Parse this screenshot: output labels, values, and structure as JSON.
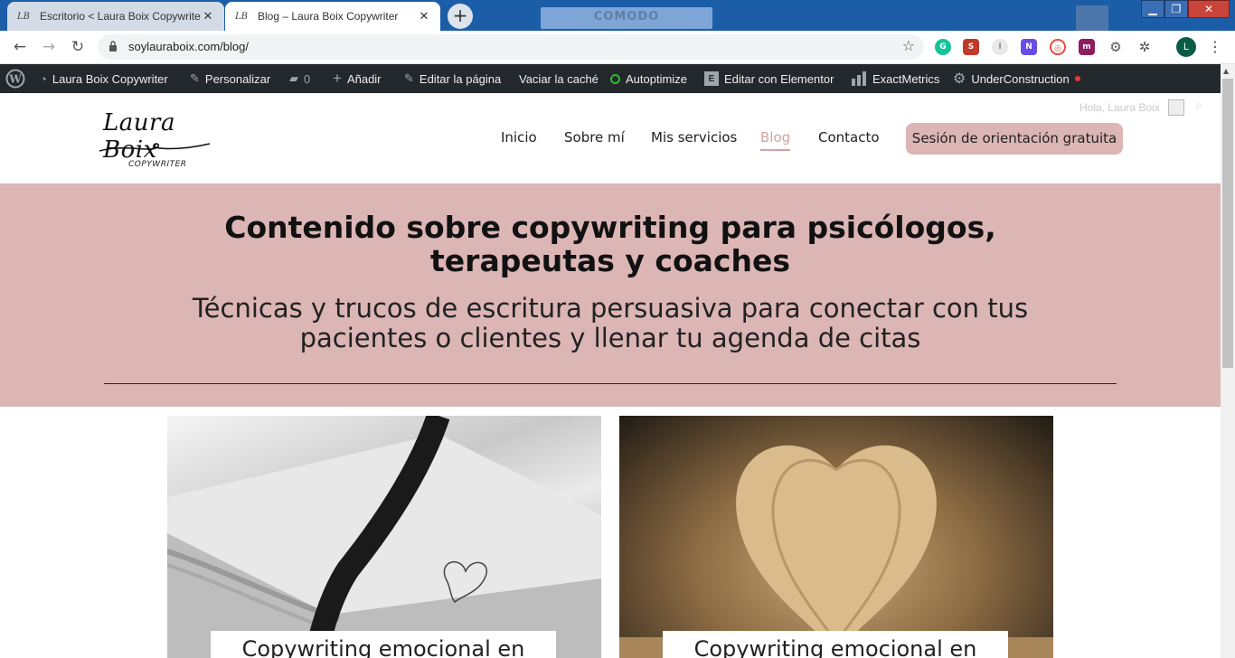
{
  "browser": {
    "tabs": [
      {
        "title": "Escritorio < Laura Boix Copywrite",
        "favicon": "LB",
        "active": false
      },
      {
        "title": "Blog – Laura Boix Copywriter",
        "favicon": "LB",
        "active": true
      }
    ],
    "new_tab_label": "+",
    "background_label": "COMODO",
    "window_controls": {
      "minimize": "▁",
      "maximize": "❐",
      "close": "✕"
    },
    "url": "soylauraboix.com/blog/",
    "profile_initial": "L",
    "extension_icons": [
      "grammarly-icon",
      "seo-icon",
      "ime-icon",
      "notion-icon",
      "spark-icon",
      "deepl-icon",
      "gear-icon",
      "puzzle-icon"
    ]
  },
  "adminbar": {
    "site_name": "Laura Boix Copywriter",
    "customize": "Personalizar",
    "comments_count": "0",
    "add_new": "Añadir",
    "edit_page": "Editar la página",
    "clear_cache": "Vaciar la caché",
    "autoptimize": "Autoptimize",
    "elementor": "Editar con Elementor",
    "exactmetrics": "ExactMetrics",
    "underconstruction": "UnderConstruction"
  },
  "header": {
    "logo_name": "Laura Boix",
    "logo_tagline": "COPYWRITER",
    "greeting": "Hola, Laura Boix",
    "nav": [
      {
        "label": "Inicio"
      },
      {
        "label": "Sobre mí"
      },
      {
        "label": "Mis servicios"
      },
      {
        "label": "Blog",
        "active": true
      },
      {
        "label": "Contacto"
      }
    ],
    "cta": "Sesión de orientación gratuita"
  },
  "hero": {
    "title": "Contenido sobre copywriting para psicólogos, terapeutas y coaches",
    "subtitle": "Técnicas y trucos de escritura persuasiva para conectar con tus pacientes o clientes y llenar tu agenda de citas"
  },
  "posts": [
    {
      "title": "Copywriting emocional en"
    },
    {
      "title": "Copywriting emocional en"
    }
  ],
  "colors": {
    "accent_pink": "#dcb5b5",
    "nav_active": "#d1a3a3",
    "admin_bar": "#23282d",
    "tabstrip": "#1c5da8"
  }
}
